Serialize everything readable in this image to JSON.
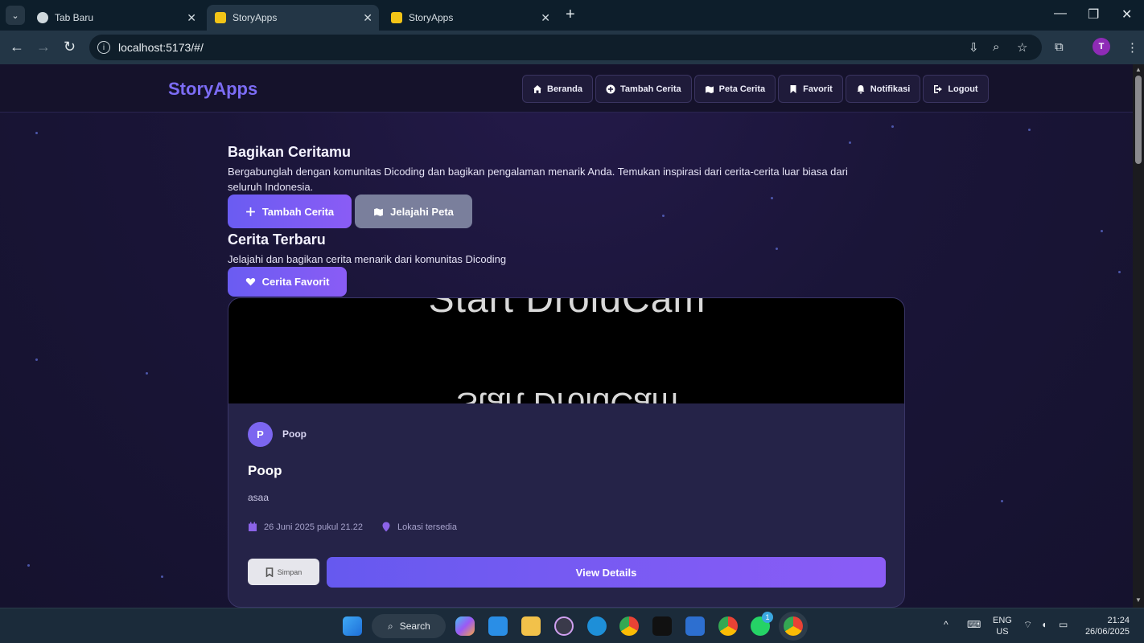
{
  "browser": {
    "tabs": [
      {
        "title": "Tab Baru",
        "active": false
      },
      {
        "title": "StoryApps",
        "active": true
      },
      {
        "title": "StoryApps",
        "active": false
      }
    ],
    "url": "localhost:5173/#/",
    "profile_initial": "T"
  },
  "site": {
    "logo": "StoryApps",
    "nav": [
      {
        "label": "Beranda",
        "icon": "home-icon"
      },
      {
        "label": "Tambah Cerita",
        "icon": "plus-circle-icon"
      },
      {
        "label": "Peta Cerita",
        "icon": "map-icon"
      },
      {
        "label": "Favorit",
        "icon": "bookmark-icon"
      },
      {
        "label": "Notifikasi",
        "icon": "bell-icon"
      },
      {
        "label": "Logout",
        "icon": "logout-icon"
      }
    ]
  },
  "hero": {
    "title": "Bagikan Ceritamu",
    "description": "Bergabunglah dengan komunitas Dicoding dan bagikan pengalaman menarik Anda. Temukan inspirasi dari cerita-cerita luar biasa dari seluruh Indonesia.",
    "primary_button": "Tambah Cerita",
    "secondary_button": "Jelajahi Peta"
  },
  "latest": {
    "title": "Cerita Terbaru",
    "description": "Jelajahi dan bagikan cerita menarik dari komunitas Dicoding",
    "favorite_button": "Cerita Favorit"
  },
  "story": {
    "image_text_top": "Start DroidCam",
    "image_text_bottom": "Start DroidCam",
    "avatar_initial": "P",
    "author": "Poop",
    "title": "Poop",
    "description": "asaa",
    "date": "26 Juni 2025 pukul 21.22",
    "location": "Lokasi tersedia",
    "save_label": "Simpan",
    "details_label": "View Details"
  },
  "taskbar": {
    "search_label": "Search",
    "lang_line1": "ENG",
    "lang_line2": "US",
    "time": "21:24",
    "date": "26/06/2025",
    "whatsapp_badge": "1"
  },
  "colors": {
    "accent": "#7c6cf5",
    "button_gradient_start": "#6659ef",
    "button_gradient_end": "#8b5cf6"
  }
}
